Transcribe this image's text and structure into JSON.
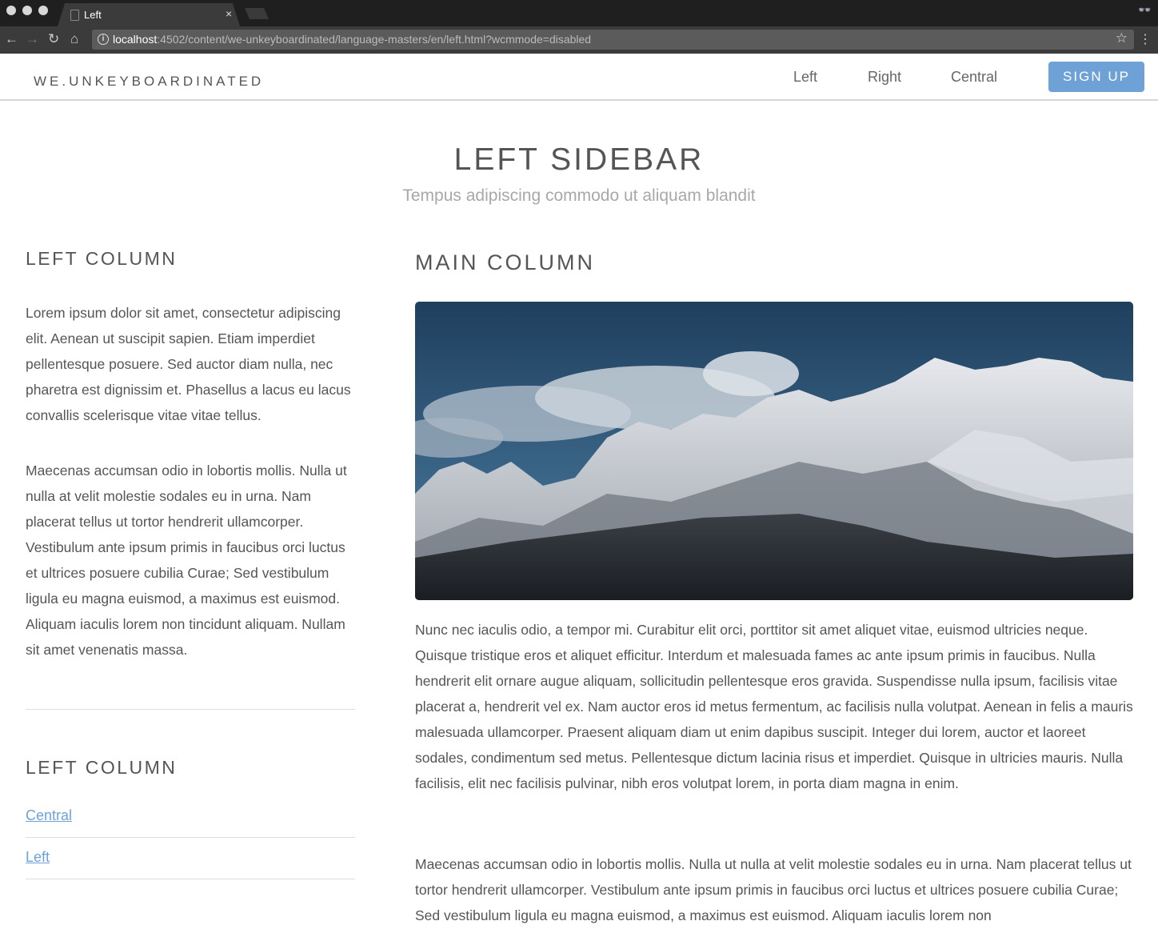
{
  "browser": {
    "tab_title": "Left",
    "tab_close": "×",
    "url_host": "localhost",
    "url_rest": ":4502/content/we-unkeyboardinated/language-masters/en/left.html?wcmmode=disabled",
    "back": "←",
    "forward": "→",
    "reload": "↻",
    "home": "⌂",
    "info": "i",
    "star": "☆",
    "menu": "⋮",
    "incognito": "👓"
  },
  "header": {
    "brand": "WE.UNKEYBOARDINATED",
    "nav": [
      {
        "label": "Left"
      },
      {
        "label": "Right"
      },
      {
        "label": "Central"
      }
    ],
    "signup_label": "SIGN UP"
  },
  "page": {
    "title": "LEFT SIDEBAR",
    "subtitle": "Tempus adipiscing commodo ut aliquam blandit"
  },
  "left_column": {
    "heading": "LEFT COLUMN",
    "paragraphs": [
      "Lorem ipsum dolor sit amet, consectetur adipiscing elit. Aenean ut suscipit sapien. Etiam imperdiet pellentesque posuere. Sed auctor diam nulla, nec pharetra est dignissim et. Phasellus a lacus eu lacus convallis scelerisque vitae vitae tellus.",
      "Maecenas accumsan odio in lobortis mollis. Nulla ut nulla at velit molestie sodales eu in urna. Nam placerat tellus ut tortor hendrerit ullamcorper. Vestibulum ante ipsum primis in faucibus orci luctus et ultrices posuere cubilia Curae; Sed vestibulum ligula eu magna euismod, a maximus est euismod. Aliquam iaculis lorem non tincidunt aliquam. Nullam sit amet venenatis massa."
    ],
    "heading2": "LEFT COLUMN",
    "links": [
      {
        "label": "Central"
      },
      {
        "label": "Left"
      }
    ]
  },
  "main_column": {
    "heading": "MAIN COLUMN",
    "image": "mountain-landscape-image",
    "paragraphs": [
      "Nunc nec iaculis odio, a tempor mi. Curabitur elit orci, porttitor sit amet aliquet vitae, euismod ultricies neque. Quisque tristique eros et aliquet efficitur. Interdum et malesuada fames ac ante ipsum primis in faucibus. Nulla hendrerit elit ornare augue aliquam, sollicitudin pellentesque eros gravida. Suspendisse nulla ipsum, facilisis vitae placerat a, hendrerit vel ex. Nam auctor eros id metus fermentum, ac facilisis nulla volutpat. Aenean in felis a mauris malesuada ullamcorper. Praesent aliquam diam ut enim dapibus suscipit. Integer dui lorem, auctor et laoreet sodales, condimentum sed metus. Pellentesque dictum lacinia risus et imperdiet. Quisque in ultricies mauris. Nulla facilisis, elit nec facilisis pulvinar, nibh eros volutpat lorem, in porta diam magna in enim.",
      "Maecenas accumsan odio in lobortis mollis. Nulla ut nulla at velit molestie sodales eu in urna. Nam placerat tellus ut tortor hendrerit ullamcorper. Vestibulum ante ipsum primis in faucibus orci luctus et ultrices posuere cubilia Curae; Sed vestibulum ligula eu magna euismod, a maximus est euismod. Aliquam iaculis lorem non"
    ]
  },
  "colors": {
    "accent": "#6ea2d6",
    "text": "#555555",
    "subtitle": "#a8a8a8",
    "chrome_dark": "#1f1f1f",
    "chrome_toolbar": "#3b3b3b"
  }
}
